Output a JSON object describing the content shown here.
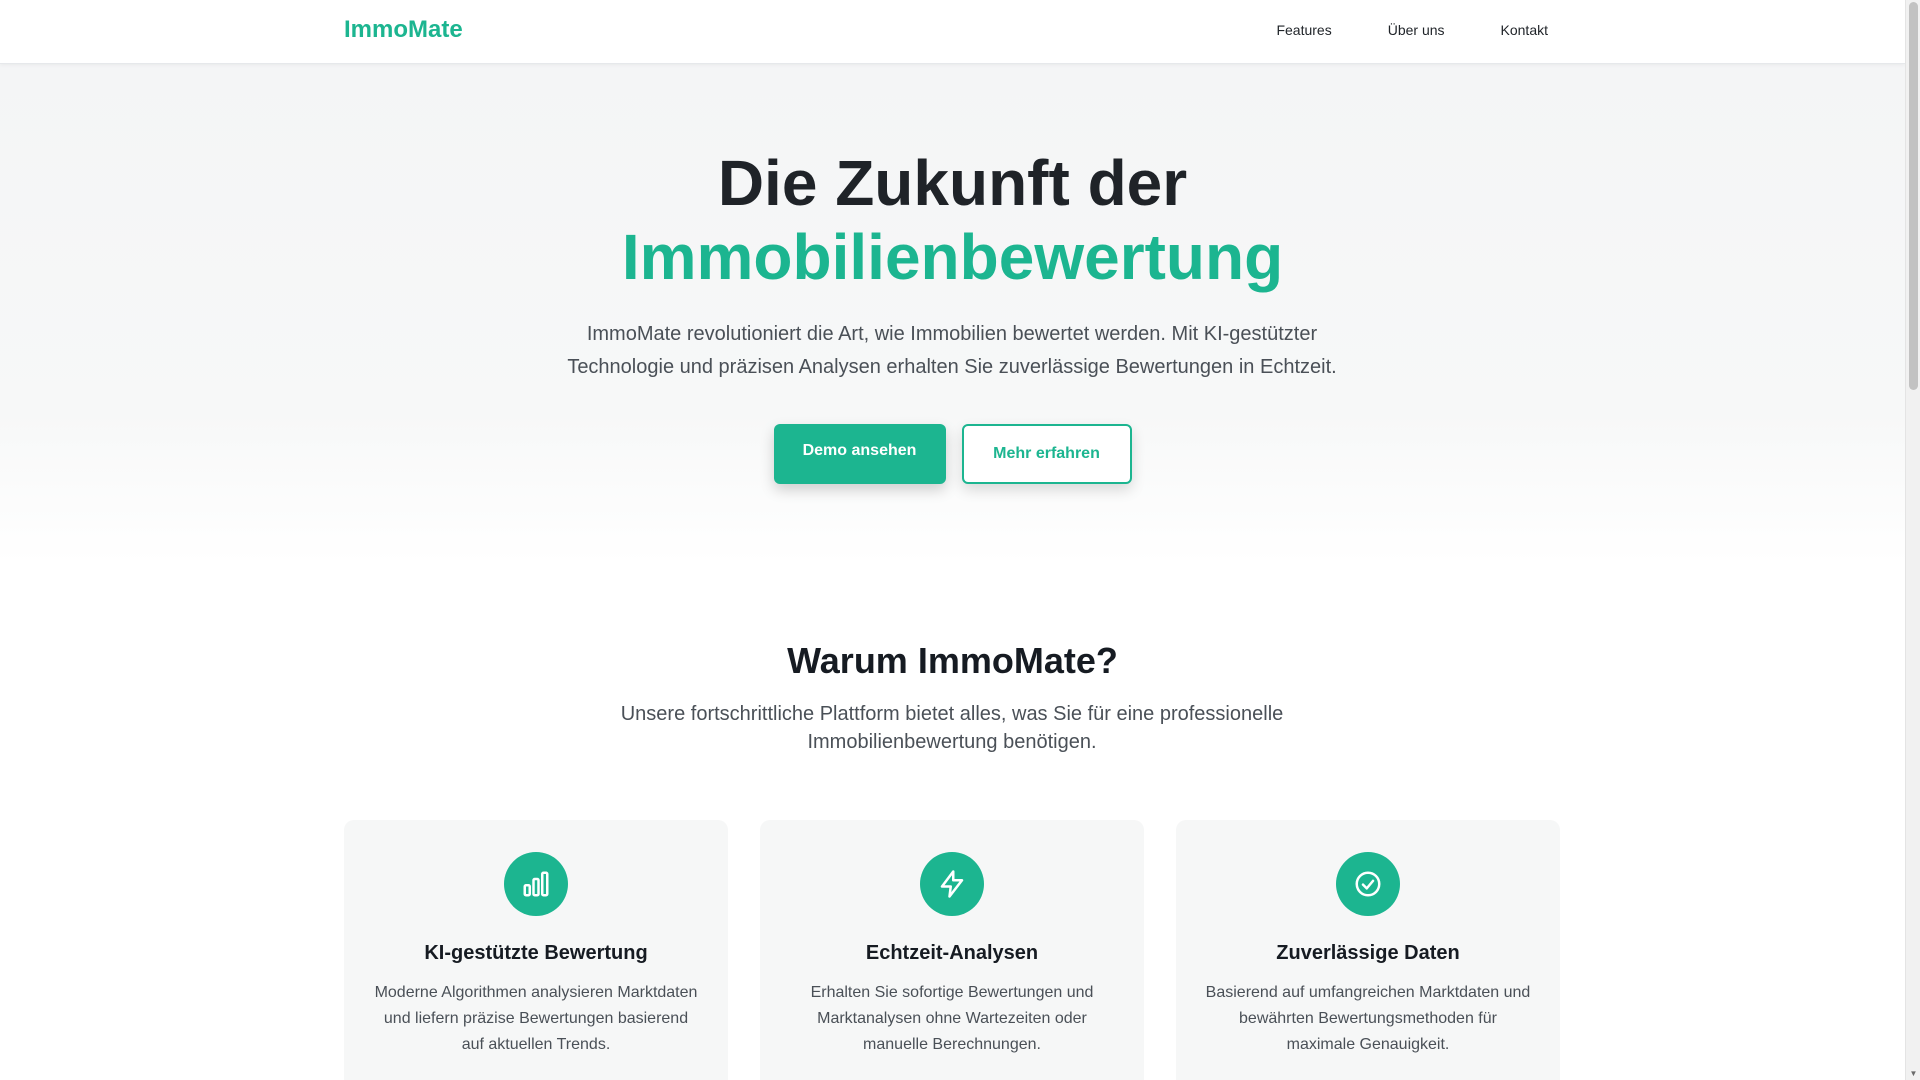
{
  "brand": {
    "name": "ImmoMate",
    "accent_color": "#1cb590"
  },
  "nav": {
    "items": [
      {
        "label": "Features"
      },
      {
        "label": "Über uns"
      },
      {
        "label": "Kontakt"
      }
    ]
  },
  "hero": {
    "title_line1": "Die Zukunft der",
    "title_line2": "Immobilienbewertung",
    "subtitle": "ImmoMate revolutioniert die Art, wie Immobilien bewertet werden. Mit KI-gestützter Technologie und präzisen Analysen erhalten Sie zuverlässige Bewertungen in Echtzeit.",
    "primary_button": "Demo ansehen",
    "secondary_button": "Mehr erfahren"
  },
  "features": {
    "title": "Warum ImmoMate?",
    "subtitle": "Unsere fortschrittliche Plattform bietet alles, was Sie für eine professionelle Immobilienbewertung benötigen.",
    "cards": [
      {
        "icon": "bar-chart-icon",
        "title": "KI-gestützte Bewertung",
        "text": "Moderne Algorithmen analysieren Marktdaten und liefern präzise Bewertungen basierend auf aktuellen Trends."
      },
      {
        "icon": "lightning-icon",
        "title": "Echtzeit-Analysen",
        "text": "Erhalten Sie sofortige Bewertungen und Marktanalysen ohne Wartezeiten oder manuelle Berechnungen."
      },
      {
        "icon": "check-circle-icon",
        "title": "Zuverlässige Daten",
        "text": "Basierend auf umfangreichen Marktdaten und bewährten Bewertungsmethoden für maximale Genauigkeit."
      }
    ]
  }
}
